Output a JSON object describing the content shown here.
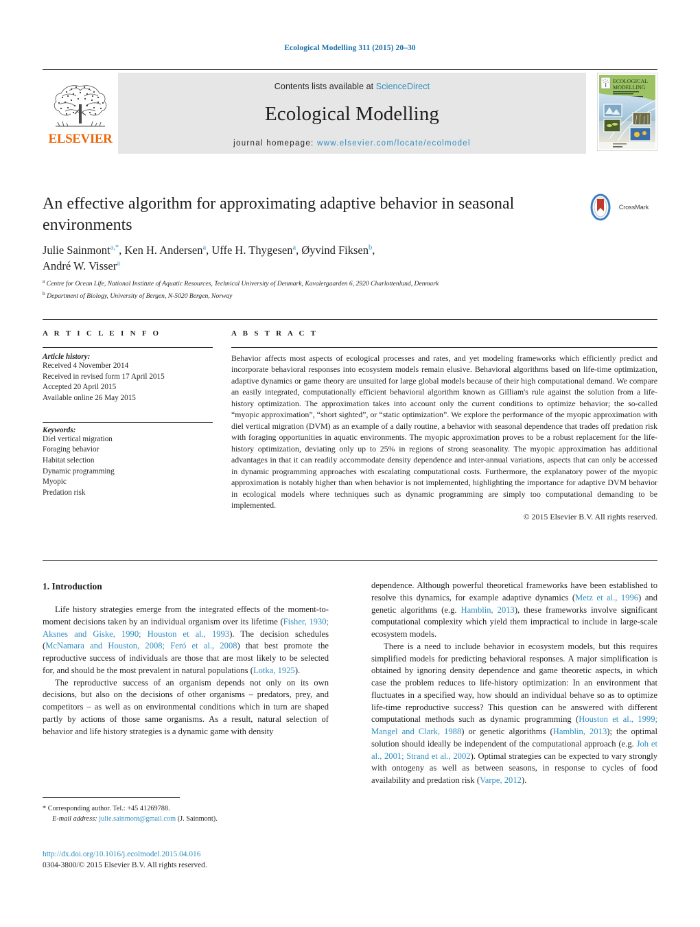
{
  "running_head": "Ecological Modelling 311 (2015) 20–30",
  "masthead": {
    "publisher_name": "ELSEVIER",
    "contents_prefix": "Contents lists available at ",
    "contents_link": "ScienceDirect",
    "journal_title": "Ecological Modelling",
    "homepage_prefix": "journal homepage: ",
    "homepage_url": "www.elsevier.com/locate/ecolmodel",
    "cover_title_line1": "ECOLOGICAL",
    "cover_title_line2": "MODELLING"
  },
  "article": {
    "title": "An effective algorithm for approximating adaptive behavior in seasonal environments",
    "crossmark_label": "CrossMark",
    "authors_line1_a": "Julie Sainmont",
    "authors_line1_a_sup": "a,*",
    "authors_line1_b": ", Ken H. Andersen",
    "authors_line1_b_sup": "a",
    "authors_line1_c": ", Uffe H. Thygesen",
    "authors_line1_c_sup": "a",
    "authors_line1_d": ", Øyvind Fiksen",
    "authors_line1_d_sup": "b",
    "authors_line1_end": ",",
    "authors_line2": "André W. Visser",
    "authors_line2_sup": "a",
    "affiliation_a_marker": "a",
    "affiliation_a": "Centre for Ocean Life, National Institute of Aquatic Resources, Technical University of Denmark, Kavalergaarden 6, 2920 Charlottenlund, Denmark",
    "affiliation_b_marker": "b",
    "affiliation_b": "Department of Biology, University of Bergen, N-5020 Bergen, Norway"
  },
  "article_info": {
    "heading": "A R T I C L E   I N F O",
    "history_label": "Article history:",
    "history": [
      "Received 4 November 2014",
      "Received in revised form 17 April 2015",
      "Accepted 20 April 2015",
      "Available online 26 May 2015"
    ],
    "keywords_label": "Keywords:",
    "keywords": [
      "Diel vertical migration",
      "Foraging behavior",
      "Habitat selection",
      "Dynamic programming",
      "Myopic",
      "Predation risk"
    ]
  },
  "abstract": {
    "heading": "A B S T R A C T",
    "text": "Behavior affects most aspects of ecological processes and rates, and yet modeling frameworks which efficiently predict and incorporate behavioral responses into ecosystem models remain elusive. Behavioral algorithms based on life-time optimization, adaptive dynamics or game theory are unsuited for large global models because of their high computational demand. We compare an easily integrated, computationally efficient behavioral algorithm known as Gilliam's rule against the solution from a life-history optimization. The approximation takes into account only the current conditions to optimize behavior; the so-called “myopic approximation”, “short sighted”, or “static optimization”. We explore the performance of the myopic approximation with diel vertical migration (DVM) as an example of a daily routine, a behavior with seasonal dependence that trades off predation risk with foraging opportunities in aquatic environments. The myopic approximation proves to be a robust replacement for the life-history optimization, deviating only up to 25% in regions of strong seasonality. The myopic approximation has additional advantages in that it can readily accommodate density dependence and inter-annual variations, aspects that can only be accessed in dynamic programming approaches with escalating computational costs. Furthermore, the explanatory power of the myopic approximation is notably higher than when behavior is not implemented, highlighting the importance for adaptive DVM behavior in ecological models where techniques such as dynamic programming are simply too computational demanding to be implemented.",
    "copyright": "© 2015 Elsevier B.V. All rights reserved."
  },
  "body": {
    "section_number_title": "1.  Introduction",
    "left_p1_part1": "Life history strategies emerge from the integrated effects of the moment-to-moment decisions taken by an individual organism over its lifetime (",
    "left_p1_ref1": "Fisher, 1930; Aksnes and Giske, 1990; Houston et al., 1993",
    "left_p1_part2": "). The decision schedules (",
    "left_p1_ref2": "McNamara and Houston, 2008; Feró et al., 2008",
    "left_p1_part3": ") that best promote the reproductive success of individuals are those that are most likely to be selected for, and should be the most prevalent in natural populations (",
    "left_p1_ref3": "Lotka, 1925",
    "left_p1_part4": ").",
    "left_p2": "The reproductive success of an organism depends not only on its own decisions, but also on the decisions of other organisms – predators, prey, and competitors – as well as on environmental conditions which in turn are shaped partly by actions of those same organisms. As a result, natural selection of behavior and life history strategies is a dynamic game with density",
    "right_p1_part1": "dependence. Although powerful theoretical frameworks have been established to resolve this dynamics, for example adaptive dynamics (",
    "right_p1_ref1": "Metz et al., 1996",
    "right_p1_part2": ") and genetic algorithms (e.g. ",
    "right_p1_ref2": "Hamblin, 2013",
    "right_p1_part3": "), these frameworks involve significant computational complexity which yield them impractical to include in large-scale ecosystem models.",
    "right_p2_part1": "There is a need to include behavior in ecosystem models, but this requires simplified models for predicting behavioral responses. A major simplification is obtained by ignoring density dependence and game theoretic aspects, in which case the problem reduces to life-history optimization: In an environment that fluctuates in a specified way, how should an individual behave so as to optimize life-time reproductive success? This question can be answered with different computational methods such as dynamic programming (",
    "right_p2_ref1": "Houston et al., 1999; Mangel and Clark, 1988",
    "right_p2_part2": ") or genetic algorithms (",
    "right_p2_ref2": "Hamblin, 2013",
    "right_p2_part3": "); the optimal solution should ideally be independent of the computational approach (e.g. ",
    "right_p2_ref3": "Joh et al., 2001; Strand et al., 2002",
    "right_p2_part4": "). Optimal strategies can be expected to vary strongly with ontogeny as well as between seasons, in response to cycles of food availability and predation risk (",
    "right_p2_ref4": "Varpe, 2012",
    "right_p2_part5": ")."
  },
  "footnotes": {
    "corresponding_marker": "*",
    "corresponding_text": "Corresponding author. Tel.: +45 41269788.",
    "email_label": "E-mail address:",
    "email": "julie.sainmont@gmail.com",
    "email_owner": "(J. Sainmont).",
    "doi": "http://dx.doi.org/10.1016/j.ecolmodel.2015.04.016",
    "issn_line": "0304-3800/© 2015 Elsevier B.V. All rights reserved."
  },
  "colors": {
    "link": "#2e8ec1",
    "elsevier_orange": "#ec6608",
    "masthead_gray": "#e6e6e6",
    "text": "#231f20"
  }
}
